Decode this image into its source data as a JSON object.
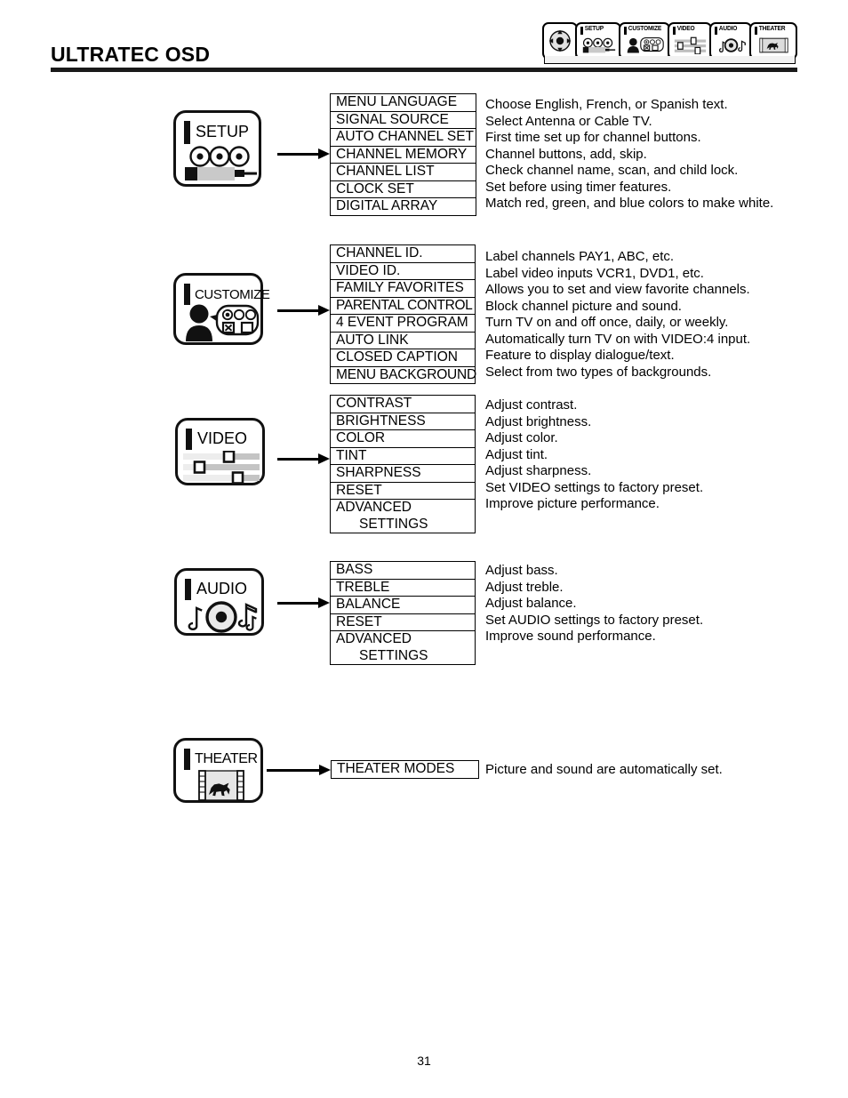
{
  "document": {
    "title": "ULTRATEC OSD",
    "page_number": "31"
  },
  "osd_bar": {
    "navpad": {
      "icon": "dpad-navigation-icon"
    },
    "tabs": [
      {
        "label": "SETUP",
        "icon": "setup-jacks-icon"
      },
      {
        "label": "CUSTOMIZE",
        "icon": "customize-person-icon"
      },
      {
        "label": "VIDEO",
        "icon": "video-sliders-icon"
      },
      {
        "label": "AUDIO",
        "icon": "audio-dial-icon"
      },
      {
        "label": "THEATER",
        "icon": "theater-filmstrip-icon"
      }
    ]
  },
  "sections": [
    {
      "id": "setup",
      "icon_label": "SETUP",
      "icon_name": "setup-jacks-icon",
      "items": [
        {
          "label": "MENU LANGUAGE",
          "desc": "Choose English, French, or Spanish text."
        },
        {
          "label": "SIGNAL SOURCE",
          "desc": "Select Antenna or Cable TV."
        },
        {
          "label": "AUTO CHANNEL SET",
          "desc": "First time set up for channel buttons."
        },
        {
          "label": "CHANNEL MEMORY",
          "desc": "Channel buttons, add, skip."
        },
        {
          "label": "CHANNEL LIST",
          "desc": "Check channel name, scan, and child lock."
        },
        {
          "label": "CLOCK SET",
          "desc": "Set before using timer features."
        },
        {
          "label": "DIGITAL ARRAY",
          "desc": "Match red, green, and blue colors to make white."
        }
      ]
    },
    {
      "id": "customize",
      "icon_label": "CUSTOMIZE",
      "icon_name": "customize-person-icon",
      "items": [
        {
          "label": "CHANNEL ID.",
          "desc": "Label channels PAY1, ABC, etc."
        },
        {
          "label": "VIDEO ID.",
          "desc": "Label video inputs VCR1, DVD1, etc."
        },
        {
          "label": "FAMILY FAVORITES",
          "desc": "Allows you to set and view favorite channels."
        },
        {
          "label": "PARENTAL CONTROL",
          "desc": "Block channel picture and sound."
        },
        {
          "label": "4 EVENT PROGRAM",
          "desc": "Turn TV on and off once, daily, or weekly."
        },
        {
          "label": "AUTO LINK",
          "desc": "Automatically turn TV on with VIDEO:4 input."
        },
        {
          "label": "CLOSED CAPTION",
          "desc": "Feature to display dialogue/text."
        },
        {
          "label": "MENU BACKGROUND",
          "desc": "Select from two types of backgrounds."
        }
      ]
    },
    {
      "id": "video",
      "icon_label": "VIDEO",
      "icon_name": "video-sliders-icon",
      "items": [
        {
          "label": "CONTRAST",
          "desc": "Adjust contrast."
        },
        {
          "label": "BRIGHTNESS",
          "desc": "Adjust brightness."
        },
        {
          "label": "COLOR",
          "desc": "Adjust color."
        },
        {
          "label": "TINT",
          "desc": "Adjust tint."
        },
        {
          "label": "SHARPNESS",
          "desc": "Adjust sharpness."
        },
        {
          "label": "RESET",
          "desc": "Set VIDEO settings to factory preset."
        },
        {
          "label": "ADVANCED",
          "label2": "SETTINGS",
          "desc": "Improve picture performance."
        }
      ]
    },
    {
      "id": "audio",
      "icon_label": "AUDIO",
      "icon_name": "audio-dial-icon",
      "items": [
        {
          "label": "BASS",
          "desc": "Adjust bass."
        },
        {
          "label": "TREBLE",
          "desc": "Adjust treble."
        },
        {
          "label": "BALANCE",
          "desc": "Adjust balance."
        },
        {
          "label": "RESET",
          "desc": "Set AUDIO settings to factory preset."
        },
        {
          "label": "ADVANCED",
          "label2": "SETTINGS",
          "desc": "Improve sound performance."
        }
      ]
    },
    {
      "id": "theater",
      "icon_label": "THEATER",
      "icon_name": "theater-filmstrip-icon",
      "items": [
        {
          "label": "THEATER MODES",
          "desc": "Picture and sound are automatically set."
        }
      ]
    }
  ],
  "colors": {
    "ink": "#000000",
    "rule": "#1a1a1a",
    "art_gray": "#c9c9c9",
    "panel_gray": "#e9e9e9"
  }
}
